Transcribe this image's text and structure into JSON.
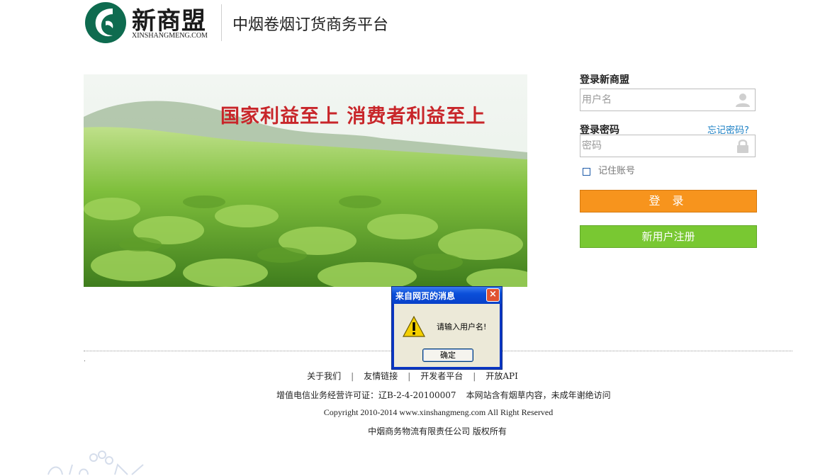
{
  "header": {
    "brand_cn": "新商盟",
    "brand_en": "XINSHANGMENG.COM",
    "platform_title": "中烟卷烟订货商务平台"
  },
  "banner": {
    "slogan": "国家利益至上  消费者利益至上"
  },
  "login": {
    "heading": "登录新商盟",
    "username_placeholder": "用户名",
    "password_heading": "登录密码",
    "forgot_password": "忘记密码?",
    "password_placeholder": "密码",
    "remember_label": "记住账号",
    "remember_checked": false,
    "login_button": "登 录",
    "register_button": "新用户注册"
  },
  "footer": {
    "dot": ".",
    "links": [
      "关于我们",
      "友情链接",
      "开发者平台",
      "开放API"
    ],
    "separator": "|",
    "license": "增值电信业务经营许可证：辽B-2-4-20100007",
    "notice": "本网站含有烟草内容，未成年谢绝访问",
    "copyright": "Copyright 2010-2014 www.xinshangmeng.com All Right Reserved",
    "owner": "中烟商务物流有限责任公司 版权所有"
  },
  "dialog": {
    "title": "来自网页的消息",
    "close_label": "×",
    "message": "请输入用户名!",
    "ok_button": "确定",
    "icon": "warning-icon"
  },
  "colors": {
    "login_button": "#f7941d",
    "register_button": "#79c832",
    "link": "#1a7fc4",
    "slogan": "#c8262a",
    "logo": "#0e6b4f"
  }
}
